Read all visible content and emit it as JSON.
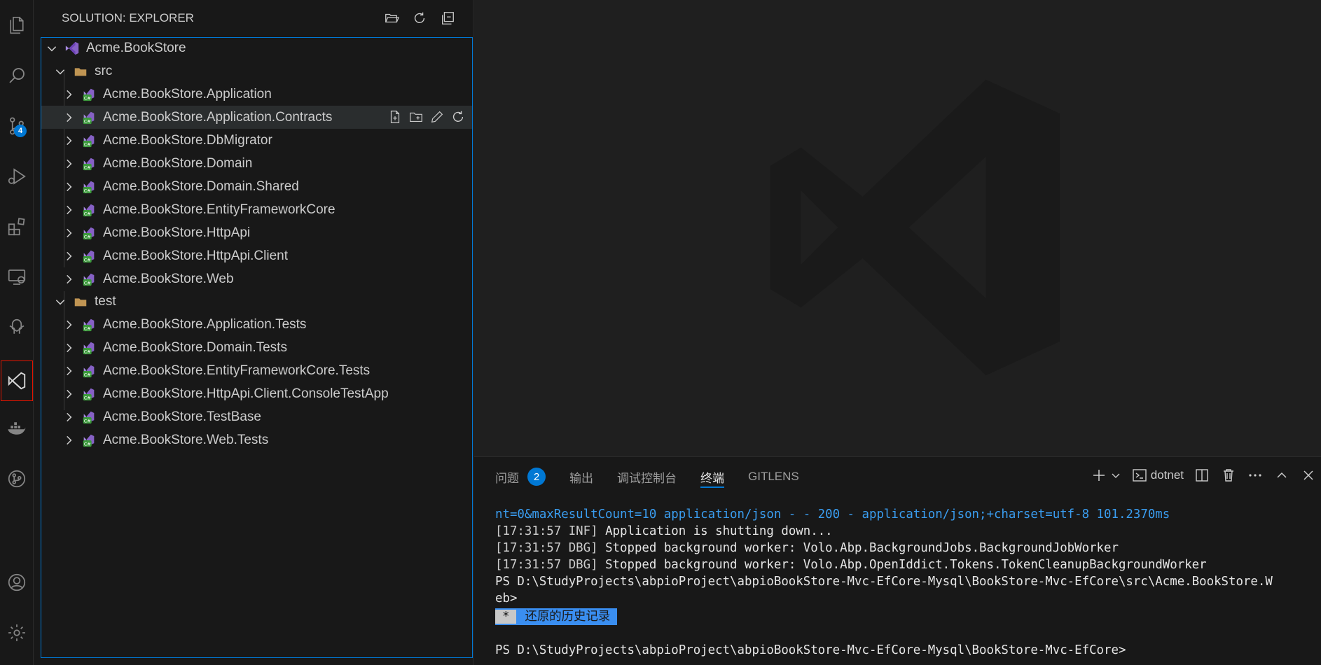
{
  "sidebar": {
    "title": "SOLUTION: EXPLORER",
    "root": "Acme.BookStore",
    "src_folder": "src",
    "test_folder": "test",
    "src_projects": [
      "Acme.BookStore.Application",
      "Acme.BookStore.Application.Contracts",
      "Acme.BookStore.DbMigrator",
      "Acme.BookStore.Domain",
      "Acme.BookStore.Domain.Shared",
      "Acme.BookStore.EntityFrameworkCore",
      "Acme.BookStore.HttpApi",
      "Acme.BookStore.HttpApi.Client",
      "Acme.BookStore.Web"
    ],
    "test_projects": [
      "Acme.BookStore.Application.Tests",
      "Acme.BookStore.Domain.Tests",
      "Acme.BookStore.EntityFrameworkCore.Tests",
      "Acme.BookStore.HttpApi.Client.ConsoleTestApp",
      "Acme.BookStore.TestBase",
      "Acme.BookStore.Web.Tests"
    ]
  },
  "activity": {
    "scm_badge": "4"
  },
  "panel": {
    "tabs": {
      "problems": "问题",
      "problems_count": "2",
      "output": "输出",
      "debug_console": "调试控制台",
      "terminal": "终端",
      "gitlens": "GITLENS"
    },
    "shell_label": "dotnet"
  },
  "terminal": {
    "line1": "nt=0&maxResultCount=10 application/json - - 200 - application/json;+charset=utf-8 101.2370ms",
    "line2_tag": "[17:31:57 INF]",
    "line2_msg": " Application is shutting down...",
    "line3_tag": "[17:31:57 DBG]",
    "line3_msg": " Stopped background worker: Volo.Abp.BackgroundJobs.BackgroundJobWorker",
    "line4_tag": "[17:31:57 DBG]",
    "line4_msg": " Stopped background worker: Volo.Abp.OpenIddict.Tokens.TokenCleanupBackgroundWorker",
    "line5": "PS D:\\StudyProjects\\abpioProject\\abpioBookStore-Mvc-EfCore-Mysql\\BookStore-Mvc-EfCore\\src\\Acme.BookStore.W",
    "line6": "eb>",
    "history_star": "*",
    "history_text": "还原的历史记录",
    "line8": "PS D:\\StudyProjects\\abpioProject\\abpioBookStore-Mvc-EfCore-Mysql\\BookStore-Mvc-EfCore>"
  },
  "colors": {
    "accent": "#0078d4",
    "selection_outline": "#e51400",
    "csproj_green": "#3c9a3c",
    "vs_purple": "#8661c5",
    "folder": "#c09553"
  }
}
